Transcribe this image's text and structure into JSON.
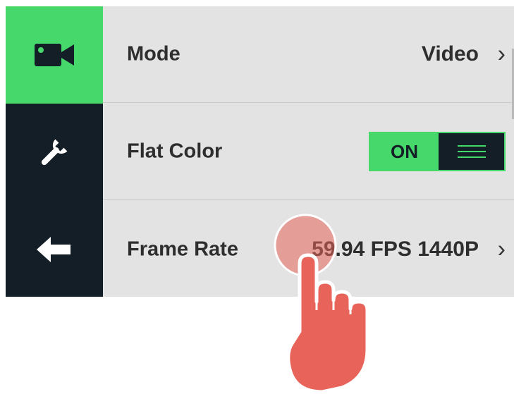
{
  "sidebar": {
    "items": [
      {
        "icon": "video-camera-icon",
        "active": true
      },
      {
        "icon": "wrench-icon",
        "active": false
      },
      {
        "icon": "arrow-left-icon",
        "active": false
      }
    ]
  },
  "settings": {
    "mode": {
      "label": "Mode",
      "value": "Video"
    },
    "flat_color": {
      "label": "Flat Color",
      "toggle_label": "ON",
      "on": true
    },
    "frame_rate": {
      "label": "Frame Rate",
      "value": "59.94 FPS 1440P"
    }
  },
  "chevron": "›",
  "colors": {
    "accent": "#46d86a",
    "sidebar_bg": "#141e26",
    "panel_bg": "#e3e3e3",
    "text": "#2e2e2e",
    "touch_indicator": "#e8645a"
  }
}
